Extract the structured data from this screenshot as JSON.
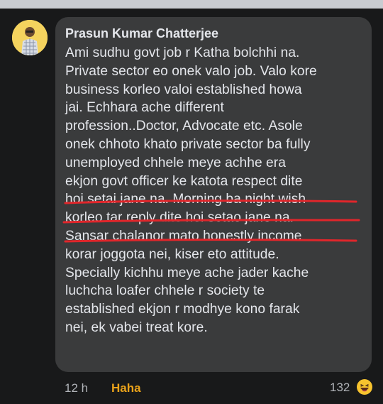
{
  "comment": {
    "author": "Prasun Kumar Chatterjee",
    "text": "Ami sudhu govt job r Katha bolchhi na.\nPrivate sector eo onek valo job. Valo kore\nbusiness korleo valoi established howa\njai. Echhara ache different\nprofession..Doctor, Advocate etc. Asole\nonek chhoto khato private sector ba fully\nunemployed chhele meye achhe era\nekjon govt officer ke katota respect dite\nhoi setai jane na. Morning ba night wish\nkorleo tar reply dite hoi setao jane na.\nSansar chalanor mato honestly income\nkorar joggota nei, kiser eto attitude.\nSpecially kichhu meye ache jader kache\nluchcha loafer chhele r society te\nestablished ekjon r modhye kono farak\nnei, ek vabei treat kore."
  },
  "footer": {
    "time": "12 h",
    "reaction_label": "Haha",
    "reaction_count": "132",
    "reaction_icon": "haha-emoji-icon"
  },
  "colors": {
    "background": "#18191a",
    "bubble": "#3a3b3c",
    "text": "#e4e6eb",
    "muted": "#b0b3b8",
    "haha": "#e9a21a",
    "underline": "#e0262b"
  }
}
